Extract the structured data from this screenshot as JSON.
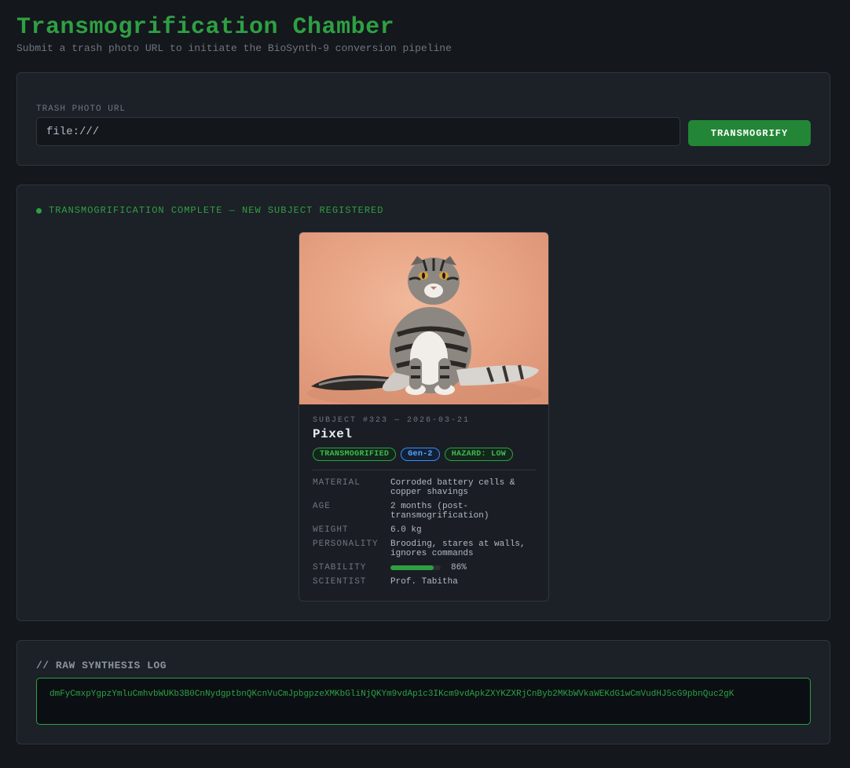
{
  "header": {
    "title": "Transmogrification Chamber",
    "subtitle": "Submit a trash photo URL to initiate the BioSynth-9 conversion pipeline"
  },
  "input_panel": {
    "field_label": "TRASH PHOTO URL",
    "url_value": "file:///",
    "submit_label": "TRANSMOGRIFY"
  },
  "result": {
    "status": "TRANSMOGRIFICATION COMPLETE — NEW SUBJECT REGISTERED",
    "card": {
      "meta": "SUBJECT #323 — 2026-03-21",
      "name": "Pixel",
      "badges": [
        "TRANSMOGRIFIED",
        "Gen-2",
        "HAZARD: LOW"
      ],
      "stats": {
        "material_label": "MATERIAL",
        "material": "Corroded battery cells & copper shavings",
        "age_label": "AGE",
        "age": "2 months (post-transmogrification)",
        "weight_label": "WEIGHT",
        "weight": "6.0 kg",
        "personality_label": "PERSONALITY",
        "personality": "Brooding, stares at walls, ignores commands",
        "stability_label": "STABILITY",
        "stability_text": "86%",
        "stability_fraction": 0.86,
        "scientist_label": "SCIENTIST",
        "scientist": "Prof. Tabitha"
      }
    }
  },
  "log": {
    "title": "// RAW SYNTHESIS LOG",
    "content": "dmFyCmxpYgpzYmluCmhvbWUKb3B0CnNydgptbnQKcnVuCmJpbgpzeXMKbGliNjQKYm9vdAp1c3IKcm9vdApkZXYKZXRjCnByb2MKbWVkaWEKdG1wCmVudHJ5cG9pbnQuc2gK"
  },
  "colors": {
    "accent": "#2ea043",
    "background": "#14171c",
    "panel": "#1c2027",
    "badge_blue": "#58a6ff"
  }
}
